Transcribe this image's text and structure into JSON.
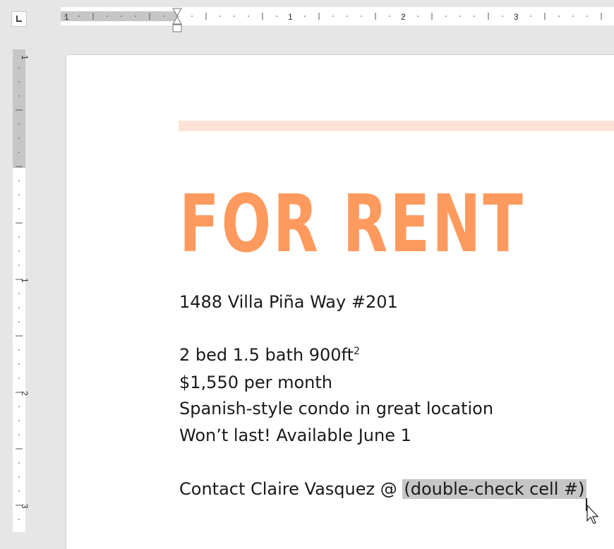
{
  "ruler": {
    "horizontal_labels": [
      "1",
      "1",
      "2",
      "3"
    ],
    "vertical_labels": [
      "1",
      "1",
      "2",
      "3"
    ]
  },
  "document": {
    "headline": "FOR RENT",
    "address": "1488 Villa Piña Way #201",
    "specs": "2 bed 1.5 bath 900ft",
    "specs_superscript": "2",
    "price": "$1,550 per month",
    "description": "Spanish-style condo in great location",
    "availability": "Won’t last! Available June 1",
    "contact_prefix": "Contact Claire Vasquez @ ",
    "contact_selected": "(double-check cell #)"
  },
  "colors": {
    "headline": "#ff9a5e",
    "accent_bar": "#fde3d6",
    "selection_highlight": "#c6c6c6",
    "ruler_margin": "#c6c6c6"
  },
  "icons": {
    "tab_selector": "left-tab-stop-icon",
    "indent_marker": "hanging-indent-marker-icon",
    "cursor": "mouse-pointer-icon"
  }
}
